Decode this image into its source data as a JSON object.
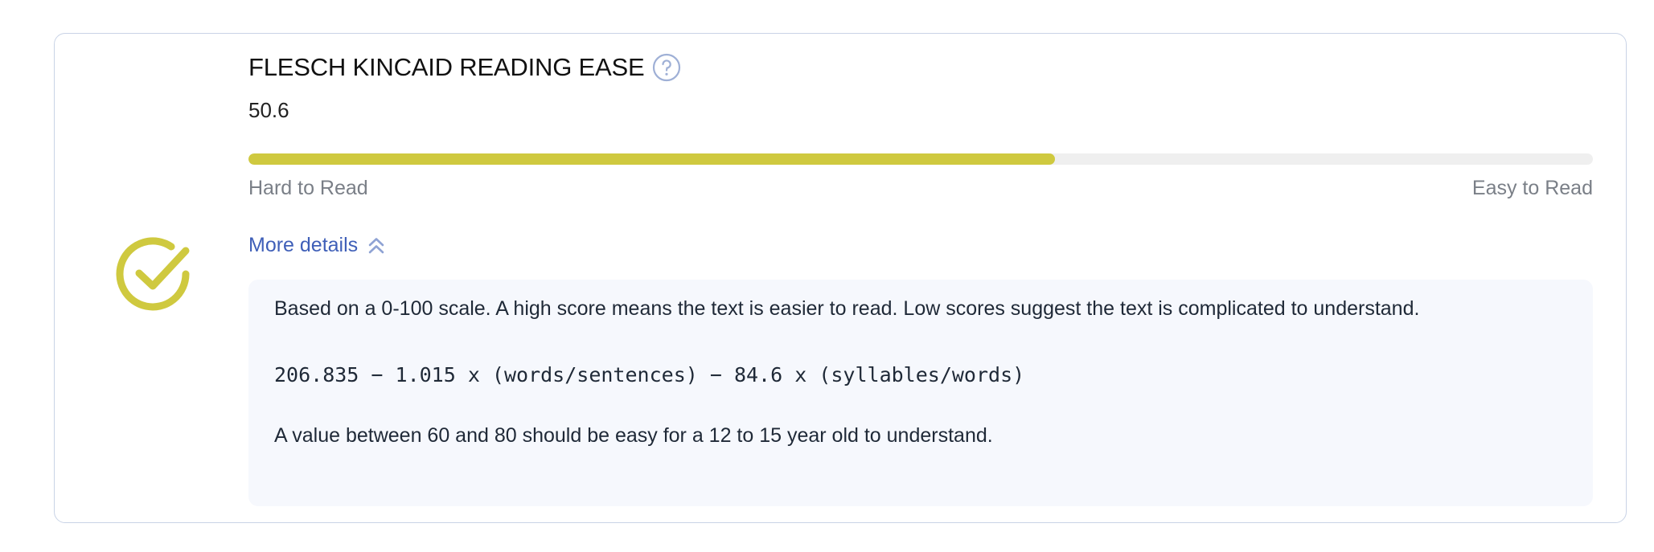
{
  "card": {
    "title": "FLESCH KINCAID READING EASE",
    "score_text": "50.6",
    "score_fraction": 0.6,
    "accent_color": "#cfc93f",
    "status_icon": "check-circle-icon",
    "help_icon": "question-circle-icon"
  },
  "scale": {
    "left_label": "Hard to Read",
    "right_label": "Easy to Read"
  },
  "details": {
    "toggle_label": "More details",
    "toggle_icon": "double-chevron-up-icon",
    "description": "Based on a 0-100 scale. A high score means the text is easier to read. Low scores suggest the text is complicated to understand.",
    "formula": "206.835 − 1.015 x (words/sentences) − 84.6 x (syllables/words)",
    "guidance": "A value between 60 and 80 should be easy for a 12 to 15 year old to understand."
  }
}
